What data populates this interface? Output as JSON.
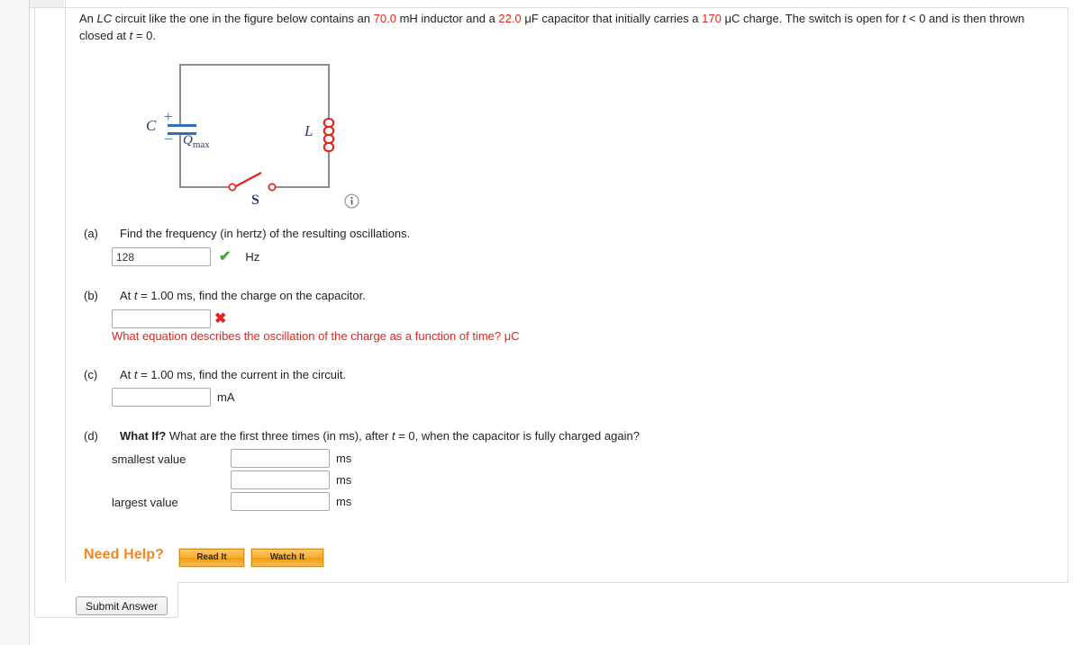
{
  "problem": {
    "text_parts": [
      {
        "t": "An ",
        "style": "plain"
      },
      {
        "t": "LC",
        "style": "italic"
      },
      {
        "t": " circuit like the one in the figure below contains an ",
        "style": "plain"
      },
      {
        "t": "70.0",
        "style": "highlight"
      },
      {
        "t": " mH inductor and a ",
        "style": "plain"
      },
      {
        "t": "22.0",
        "style": "highlight"
      },
      {
        "t": " μF capacitor that initially carries a ",
        "style": "plain"
      },
      {
        "t": "170",
        "style": "highlight"
      },
      {
        "t": " μC charge. The switch is open for ",
        "style": "plain"
      },
      {
        "t": "t",
        "style": "italic"
      },
      {
        "t": " < 0 and is then thrown closed at ",
        "style": "plain"
      },
      {
        "t": "t",
        "style": "italic"
      },
      {
        "t": " = 0.",
        "style": "plain"
      }
    ],
    "inductance": "70.0 mH",
    "capacitance": "22.0 μF",
    "initial_charge": "170 μC"
  },
  "figure": {
    "capacitor_label": "C",
    "capacitor_plus": "+",
    "capacitor_minus": "−",
    "qmax_label": "Q",
    "qmax_sub": "max",
    "inductor_label": "L",
    "switch_label": "S",
    "info_icon_glyph": "i",
    "wire_color": "#8c8c8c",
    "capacitor_color": "#2f6fb5",
    "inductor_color": "#e8221a",
    "switch_color": "#e8221a",
    "label_color": "#2b3d6b"
  },
  "parts": {
    "a": {
      "label": "(a)",
      "question": "Find the frequency (in hertz) of the resulting oscillations.",
      "answer_value": "128",
      "placeholder": "",
      "unit": "Hz",
      "mark": "✔",
      "mark_state": "correct"
    },
    "b": {
      "label": "(b)",
      "question_parts": [
        {
          "t": "At ",
          "style": "plain"
        },
        {
          "t": "t",
          "style": "italic"
        },
        {
          "t": " = 1.00 ms, find the charge on the capacitor.",
          "style": "plain"
        }
      ],
      "answer_value": "",
      "placeholder": "",
      "unit": "μC",
      "mark": "✖",
      "mark_state": "incorrect",
      "feedback": "What equation describes the oscillation of the charge as a function of time?"
    },
    "c": {
      "label": "(c)",
      "question_parts": [
        {
          "t": "At ",
          "style": "plain"
        },
        {
          "t": "t",
          "style": "italic"
        },
        {
          "t": " = 1.00 ms, find the current in the circuit.",
          "style": "plain"
        }
      ],
      "answer_value": "",
      "placeholder": "",
      "unit": "mA"
    },
    "d": {
      "label": "(d)",
      "question_parts": [
        {
          "t": "What If?",
          "style": "bold"
        },
        {
          "t": " What are the first three times (in ms), after ",
          "style": "plain"
        },
        {
          "t": "t",
          "style": "italic"
        },
        {
          "t": " = 0, when the capacitor is fully charged again?",
          "style": "plain"
        }
      ],
      "rows": [
        {
          "label": "smallest value",
          "value": "",
          "unit": "ms"
        },
        {
          "label": "",
          "value": "",
          "unit": "ms"
        },
        {
          "label": "largest value",
          "value": "",
          "unit": "ms"
        }
      ]
    }
  },
  "help": {
    "title": "Need Help?",
    "read_button": "Read It",
    "watch_button": "Watch It",
    "accent_color": "#f2871f"
  },
  "footer": {
    "submit_button": "Submit Answer"
  }
}
